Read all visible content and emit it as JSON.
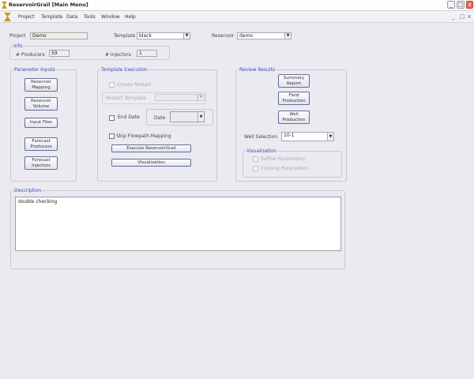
{
  "window": {
    "title": "ReservoirGrail   [Main Menu]",
    "min": "_",
    "max": "□",
    "close": "x"
  },
  "menu": [
    "Project",
    "Template",
    "Data",
    "Tools",
    "Window",
    "Help"
  ],
  "header": {
    "project_label": "Project",
    "project_value": "Demo",
    "template_label": "Template",
    "template_value": "black",
    "reservoir_label": "Reservoir",
    "reservoir_value": "demo"
  },
  "info": {
    "title": "Info",
    "producers_label": "# Producers",
    "producers_value": "59",
    "injectors_label": "# Injectors",
    "injectors_value": "1"
  },
  "parameter_inputs": {
    "title": "Parameter Inputs",
    "buttons": [
      "Reservoir\nMapping",
      "Reservoir\nVolume",
      "Input Files",
      "Forecast\nProducers",
      "Forecast\nInjectors"
    ]
  },
  "template_execution": {
    "title": "Template Execution",
    "create_restart": "Create Restart",
    "restart_template_label": "Restart Template",
    "restart_template_value": "",
    "end_date": "End Date",
    "date_label": "Date",
    "date_value": "",
    "skip_flowpath": "Skip Flowpath Mapping",
    "execute_button": "Execute ReservoirGrail",
    "visualization_button": "Visualization"
  },
  "review_results": {
    "title": "Review Results",
    "buttons": [
      "Summary\nReport",
      "Field\nProduction",
      "Well\nProduction"
    ],
    "well_selection_label": "Well Selection",
    "well_selection_value": "10-1",
    "visualization": {
      "title": "Visualization",
      "define_parameters": "Define Parameters",
      "existing_parameters": "Existing Parameters"
    }
  },
  "description": {
    "title": "Description",
    "text": "double checking"
  },
  "icons": {
    "app_icon": "hourglass-trophy-icon",
    "dropdown": "chevron-down-icon"
  },
  "colors": {
    "background": "#ebeaf1",
    "group_title": "#3a4fa8",
    "button_border": "#5f6e98"
  }
}
